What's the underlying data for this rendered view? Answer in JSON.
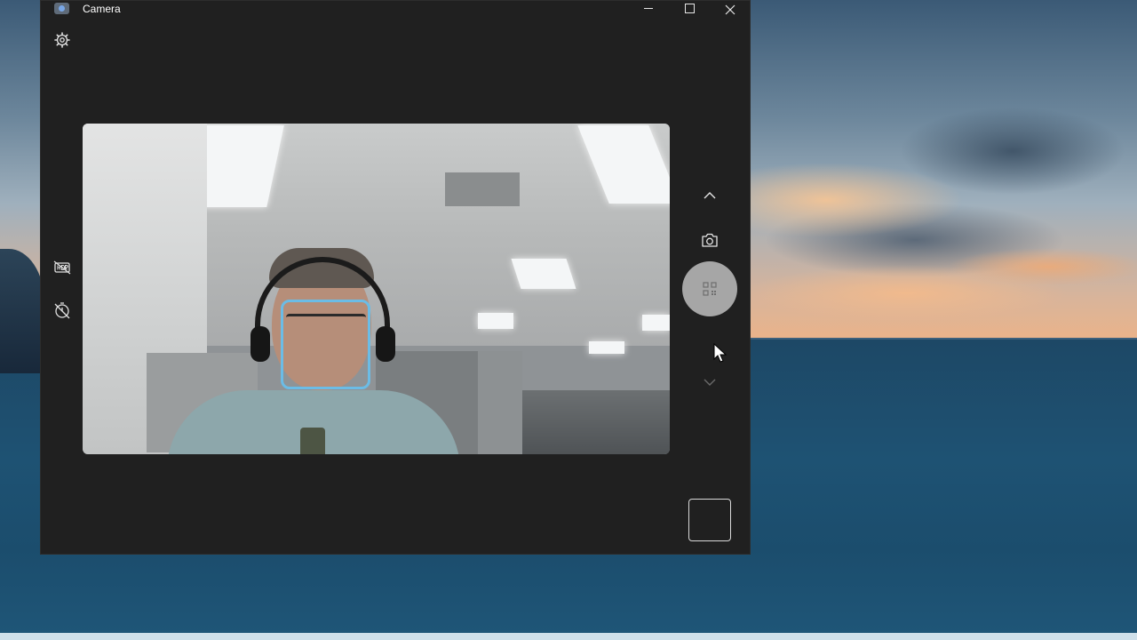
{
  "window": {
    "title": "Camera"
  },
  "icons": {
    "app": "camera-app-icon",
    "settings": "gear-icon",
    "hdr": "hdr-off-icon",
    "timer": "timer-off-icon",
    "scroll_up": "chevron-up-icon",
    "photo_mode": "camera-icon",
    "qr": "qr-code-icon",
    "scroll_down": "chevron-down-icon"
  },
  "colors": {
    "window_bg": "#202020",
    "face_detection_box": "#6bbce6",
    "shutter": "#a6a6a6"
  }
}
